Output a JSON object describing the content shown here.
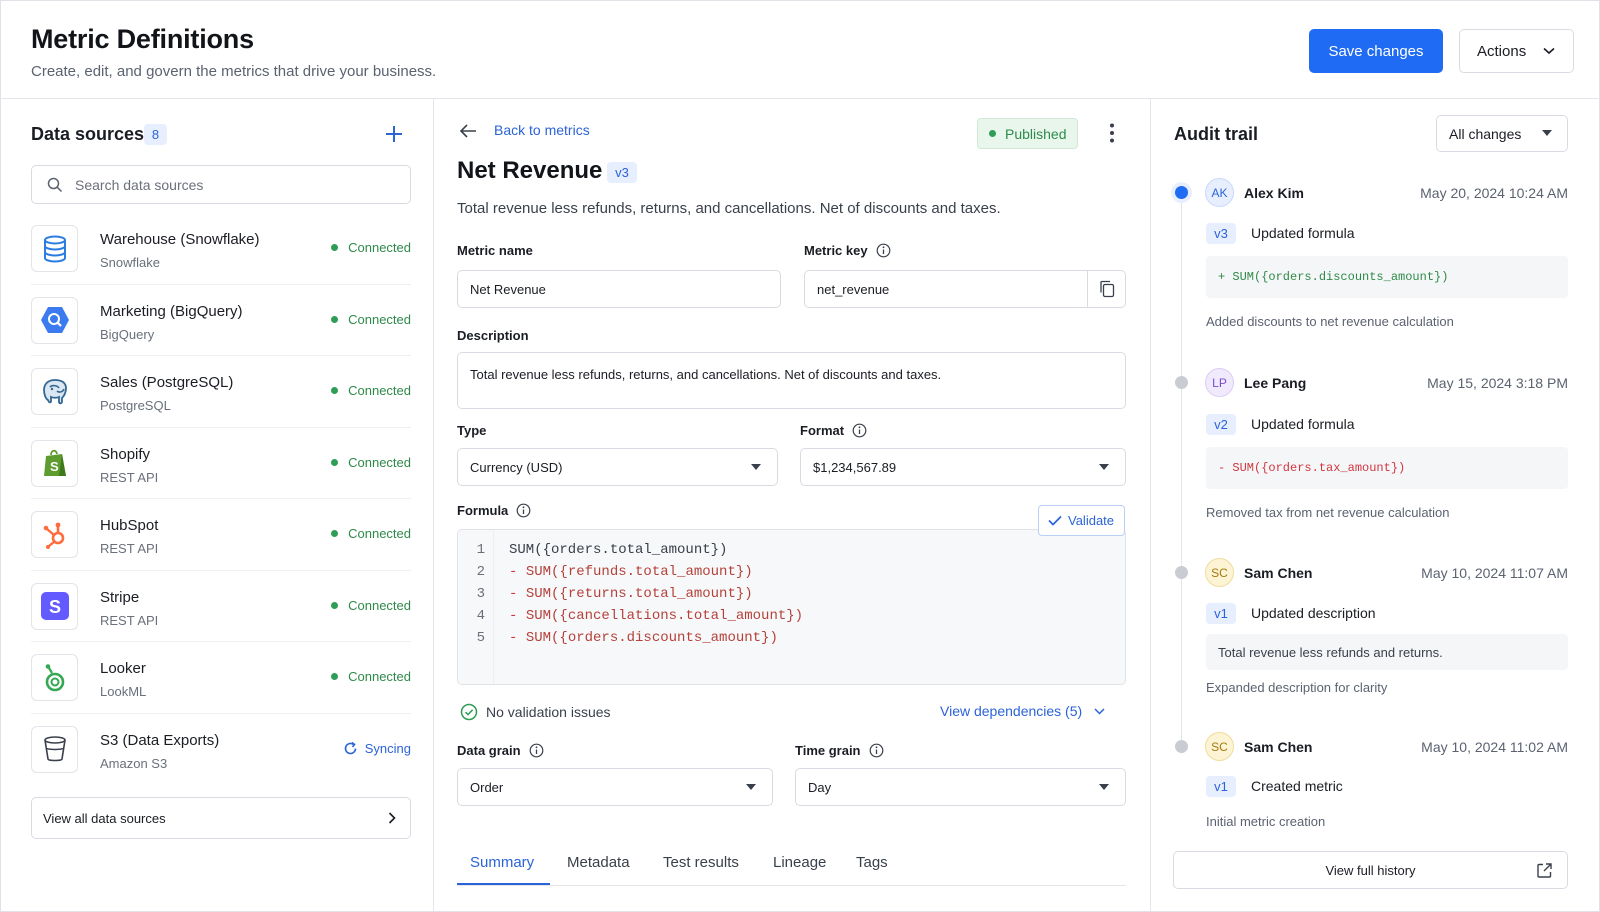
{
  "header": {
    "title": "Metric Definitions",
    "subtitle": "Create, edit, and govern the metrics that drive your business.",
    "save_label": "Save changes",
    "actions_label": "Actions"
  },
  "data_sources": {
    "title": "Data sources",
    "count": "8",
    "search_placeholder": "Search data sources",
    "items": [
      {
        "name": "Warehouse (Snowflake)",
        "type": "Snowflake",
        "status": "Connected",
        "icon": "snowflake-database-icon"
      },
      {
        "name": "Marketing (BigQuery)",
        "type": "BigQuery",
        "status": "Connected",
        "icon": "bigquery-icon"
      },
      {
        "name": "Sales (PostgreSQL)",
        "type": "PostgreSQL",
        "status": "Connected",
        "icon": "postgresql-elephant-icon"
      },
      {
        "name": "Shopify",
        "type": "REST API",
        "status": "Connected",
        "icon": "shopify-bag-icon"
      },
      {
        "name": "HubSpot",
        "type": "REST API",
        "status": "Connected",
        "icon": "hubspot-sprocket-icon"
      },
      {
        "name": "Stripe",
        "type": "REST API",
        "status": "Connected",
        "icon": "stripe-s-icon"
      },
      {
        "name": "Looker",
        "type": "LookML",
        "status": "Connected",
        "icon": "looker-icon"
      },
      {
        "name": "S3 (Data Exports)",
        "type": "Amazon S3",
        "status": "Syncing",
        "icon": "s3-bucket-icon"
      }
    ],
    "view_all_label": "View all data sources"
  },
  "metric": {
    "back_label": "Back to metrics",
    "status": "Published",
    "title": "Net Revenue",
    "version": "v3",
    "summary": "Total revenue less refunds, returns, and cancellations. Net of discounts and taxes.",
    "name_label": "Metric name",
    "name_value": "Net Revenue",
    "key_label": "Metric key",
    "key_value": "net_revenue",
    "description_label": "Description",
    "description_value": "Total revenue less refunds, returns, and cancellations. Net of discounts and taxes.",
    "type_label": "Type",
    "type_value": "Currency (USD)",
    "format_label": "Format",
    "format_value": "$1,234,567.89",
    "formula_label": "Formula",
    "validate_label": "Validate",
    "formula_lines": [
      {
        "num": "1",
        "op": "",
        "text": "SUM({orders.total_amount})"
      },
      {
        "num": "2",
        "op": "- ",
        "text": "SUM({refunds.total_amount})"
      },
      {
        "num": "3",
        "op": "- ",
        "text": "SUM({returns.total_amount})"
      },
      {
        "num": "4",
        "op": "- ",
        "text": "SUM({cancellations.total_amount})"
      },
      {
        "num": "5",
        "op": "- ",
        "text": "SUM({orders.discounts_amount})"
      }
    ],
    "validation_status": "No validation issues",
    "dependencies_label": "View dependencies (5)",
    "data_grain_label": "Data grain",
    "data_grain_value": "Order",
    "time_grain_label": "Time grain",
    "time_grain_value": "Day",
    "tabs": [
      "Summary",
      "Metadata",
      "Test results",
      "Lineage",
      "Tags"
    ]
  },
  "audit": {
    "title": "Audit trail",
    "filter_value": "All changes",
    "entries": [
      {
        "initials": "AK",
        "name": "Alex Kim",
        "date": "May 20, 2024 10:24 AM",
        "version": "v3",
        "action": "Updated formula",
        "diff": "+ SUM({orders.discounts_amount})",
        "note": "Added discounts to net revenue calculation"
      },
      {
        "initials": "LP",
        "name": "Lee Pang",
        "date": "May 15, 2024 3:18 PM",
        "version": "v2",
        "action": "Updated formula",
        "diff": "- SUM({orders.tax_amount})",
        "note": "Removed tax from net revenue calculation"
      },
      {
        "initials": "SC",
        "name": "Sam Chen",
        "date": "May 10, 2024 11:07 AM",
        "version": "v1",
        "action": "Updated description",
        "diff": "Total revenue less refunds and returns.",
        "note": "Expanded description for clarity"
      },
      {
        "initials": "SC",
        "name": "Sam Chen",
        "date": "May 10, 2024 11:02 AM",
        "version": "v1",
        "action": "Created metric",
        "diff": "",
        "note": "Initial metric creation"
      }
    ],
    "view_full_label": "View full history"
  },
  "colors": {
    "primary": "#1f6bf3",
    "link": "#2b63d8",
    "connected": "#2f8a4a",
    "removed": "#d1363f"
  }
}
